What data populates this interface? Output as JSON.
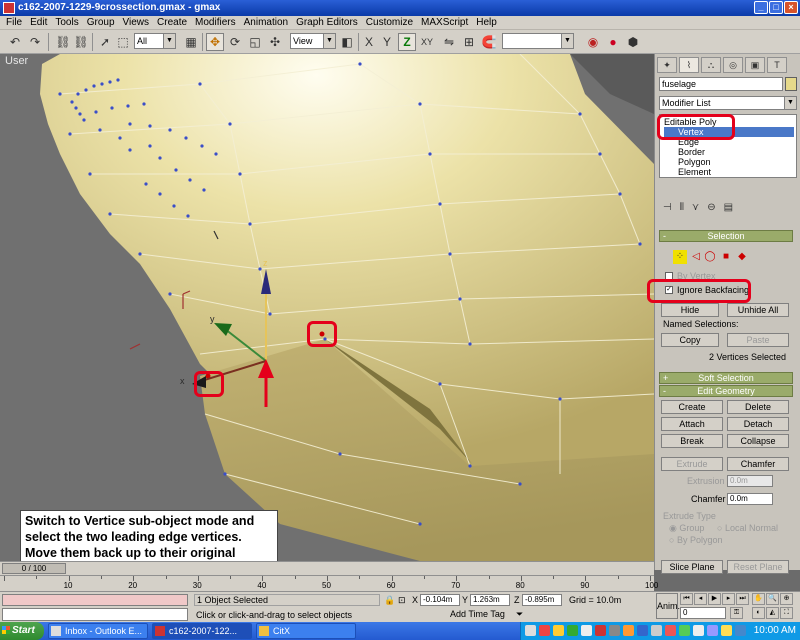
{
  "window": {
    "title": "c162-2007-1229-9crossection.gmax - gmax",
    "min": "_",
    "max": "□",
    "close": "×"
  },
  "menu": [
    "File",
    "Edit",
    "Tools",
    "Group",
    "Views",
    "Create",
    "Modifiers",
    "Animation",
    "Graph Editors",
    "Customize",
    "MAXScript",
    "Help"
  ],
  "toolbar": {
    "filter": "All",
    "refcoord": "View",
    "axis_z": "Z",
    "axis_xy": "XY",
    "named_sel": ""
  },
  "viewport": {
    "label": "User",
    "instruction": "Switch to Vertice sub-object mode and select the two leading edge vertices.  Move them back up to their original location.  Zoom in to get the position close before we weld them.",
    "axis_x": "x",
    "axis_y": "y",
    "axis_z": "z"
  },
  "command_panel": {
    "object_name": "fuselage",
    "modifier_list": "Modifier List",
    "stack": [
      "Editable Poly",
      "Vertex",
      "Edge",
      "Border",
      "Polygon",
      "Element"
    ],
    "selection": {
      "title": "Selection",
      "by_vertex": "By Vertex",
      "ignore_backfacing": "Ignore Backfacing",
      "hide": "Hide",
      "unhide_all": "Unhide All",
      "named_selections": "Named Selections:",
      "copy": "Copy",
      "paste": "Paste",
      "status": "2 Vertices Selected"
    },
    "soft_selection": "Soft Selection",
    "edit_geometry": {
      "title": "Edit Geometry",
      "create": "Create",
      "delete": "Delete",
      "attach": "Attach",
      "detach": "Detach",
      "break": "Break",
      "collapse": "Collapse",
      "extrude": "Extrude",
      "chamfer": "Chamfer",
      "extrusion_label": "Extrusion",
      "extrusion_value": "0.0m",
      "chamfer_label": "Chamfer",
      "chamfer_value": "0.0m",
      "extrude_type": "Extrude Type",
      "group": "Group",
      "local_normal": "Local Normal",
      "by_polygon": "By Polygon",
      "slice_plane": "Slice Plane",
      "reset_plane": "Reset Plane"
    }
  },
  "timeline": {
    "slider": "0 / 100",
    "ticks": [
      "10",
      "20",
      "30",
      "40",
      "50",
      "60",
      "70",
      "80",
      "90",
      "100"
    ]
  },
  "status": {
    "selected": "1 Object Selected",
    "prompt": "Click or click-and-drag to select objects",
    "x_label": "X",
    "x": "-0.104m",
    "y_label": "Y",
    "y": "1.263m",
    "z_label": "Z",
    "z": "-0.895m",
    "grid": "Grid = 10.0m",
    "add_time_tag": "Add Time Tag",
    "anim": "Anim.",
    "frame": "0"
  },
  "taskbar": {
    "start": "Start",
    "tasks": [
      "Inbox - Outlook E...",
      "c162-2007-122...",
      "CitX"
    ],
    "clock": "10:00 AM"
  },
  "colors": {
    "highlight_red": "#e4001b",
    "rollout": "#9aab6a",
    "mesh": "#d9cc85"
  }
}
